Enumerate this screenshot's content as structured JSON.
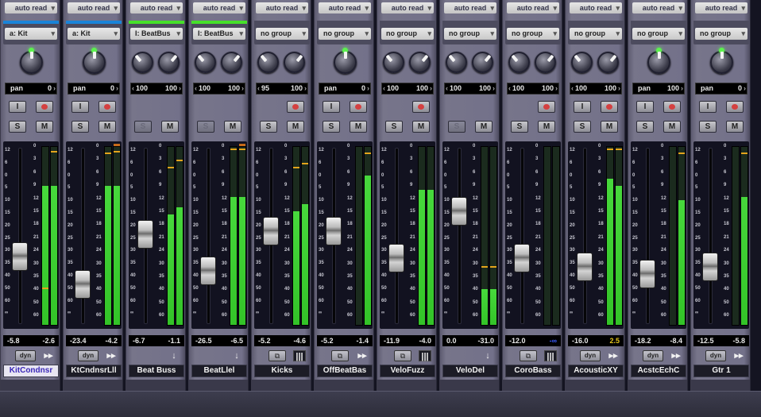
{
  "colors": {
    "meter_green": "#3fd033",
    "peak_amber": "#e3a41c",
    "record_red": "#d44040",
    "pan_knob_green": "#5cf24e",
    "selected_name_text": "#3b28b8"
  },
  "fader_scale_left": [
    "12",
    "6",
    "0",
    "5",
    "10",
    "15",
    "20",
    "25",
    "30",
    "35",
    "40",
    "50",
    "60",
    "∞"
  ],
  "meter_scale_right": [
    "0",
    "3",
    "6",
    "9",
    "12",
    "15",
    "18",
    "21",
    "24",
    "30",
    "35",
    "40",
    "50",
    "60"
  ],
  "strips": [
    {
      "automation": "auto read",
      "group": "a: Kit",
      "group_color": "#1a84d8",
      "knobs": [
        0.5
      ],
      "pan": [
        "pan",
        "0"
      ],
      "buttons": [
        "I",
        "rec",
        "S",
        "M"
      ],
      "record_visible": true,
      "solo_dim": false,
      "fader_level": 0.37,
      "meters": [
        0.78,
        0.78
      ],
      "peaks": [
        0.2,
        0.97
      ],
      "clip": false,
      "readout": [
        "-5.8",
        "-2.6"
      ],
      "row3": {
        "type": "dyn",
        "label": "dyn"
      },
      "tail": "▸▸",
      "name": "KitCondnsr",
      "selected": true
    },
    {
      "automation": "auto read",
      "group": "a: Kit",
      "group_color": "#1a84d8",
      "knobs": [
        0.5
      ],
      "pan": [
        "pan",
        "0"
      ],
      "buttons": [
        "I",
        "rec",
        "S",
        "M"
      ],
      "record_visible": true,
      "solo_dim": false,
      "fader_level": 0.18,
      "meters": [
        0.78,
        0.78
      ],
      "peaks": [
        0.96,
        0.97
      ],
      "clip": true,
      "readout": [
        "-23.4",
        "-4.2"
      ],
      "row3": {
        "type": "dyn",
        "label": "dyn"
      },
      "tail": "▸▸",
      "name": "KtCndnsrLll",
      "selected": false
    },
    {
      "automation": "auto read",
      "group": "I: BeatBus",
      "group_color": "#46e02a",
      "knobs": [
        0.3,
        0.7
      ],
      "pan": [
        "100",
        "100"
      ],
      "buttons": [
        "",
        "",
        "S",
        "M"
      ],
      "record_visible": false,
      "solo_dim": true,
      "fader_level": 0.53,
      "meters": [
        0.62,
        0.66
      ],
      "peaks": [
        0.88,
        0.92
      ],
      "clip": false,
      "readout": [
        "-6.7",
        "-1.1"
      ],
      "row3": {
        "type": "none",
        "label": ""
      },
      "tail": "↓",
      "name": "Beat Buss",
      "selected": false
    },
    {
      "automation": "auto read",
      "group": "I: BeatBus",
      "group_color": "#46e02a",
      "knobs": [
        0.3,
        0.7
      ],
      "pan": [
        "100",
        "100"
      ],
      "buttons": [
        "",
        "",
        "S",
        "M"
      ],
      "record_visible": false,
      "solo_dim": true,
      "fader_level": 0.27,
      "meters": [
        0.72,
        0.72
      ],
      "peaks": [
        0.98,
        0.98
      ],
      "clip": true,
      "readout": [
        "-26.5",
        "-6.5"
      ],
      "row3": {
        "type": "none",
        "label": ""
      },
      "tail": "↓",
      "name": "BeatLlel",
      "selected": false
    },
    {
      "automation": "auto read",
      "group": "no group",
      "group_color": "#4c4b5e",
      "knobs": [
        0.3,
        0.7
      ],
      "pan": [
        "95",
        "100"
      ],
      "buttons": [
        "",
        "rec",
        "S",
        "M"
      ],
      "record_visible": true,
      "solo_dim": false,
      "fader_level": 0.55,
      "meters": [
        0.64,
        0.68
      ],
      "peaks": [
        0.88,
        0.9
      ],
      "clip": false,
      "readout": [
        "-5.2",
        "-4.6"
      ],
      "row3": {
        "type": "icon",
        "label": "⧉"
      },
      "tail": "|||",
      "name": "Kicks",
      "selected": false
    },
    {
      "automation": "auto read",
      "group": "no group",
      "group_color": "#4c4b5e",
      "knobs": [
        0.5
      ],
      "pan": [
        "pan",
        "0"
      ],
      "buttons": [
        "I",
        "rec",
        "S",
        "M"
      ],
      "record_visible": true,
      "solo_dim": false,
      "fader_level": 0.55,
      "meters": [
        0.0,
        0.84
      ],
      "peaks": [
        0.0,
        0.96
      ],
      "clip": false,
      "readout": [
        "-5.2",
        "-1.4"
      ],
      "row3": {
        "type": "icon",
        "label": "⧉"
      },
      "tail": "▸▸",
      "name": "OffBeatBas",
      "selected": false
    },
    {
      "automation": "auto read",
      "group": "no group",
      "group_color": "#4c4b5e",
      "knobs": [
        0.3,
        0.7
      ],
      "pan": [
        "100",
        "100"
      ],
      "buttons": [
        "",
        "rec",
        "S",
        "M"
      ],
      "record_visible": true,
      "solo_dim": false,
      "fader_level": 0.36,
      "meters": [
        0.76,
        0.76
      ],
      "peaks": [
        0.0,
        0.0
      ],
      "clip": false,
      "readout": [
        "-11.9",
        "-4.0"
      ],
      "row3": {
        "type": "icon",
        "label": "⧉"
      },
      "tail": "|||",
      "name": "VeloFuzz",
      "selected": false
    },
    {
      "automation": "auto read",
      "group": "no group",
      "group_color": "#4c4b5e",
      "knobs": [
        0.3,
        0.7
      ],
      "pan": [
        "100",
        "100"
      ],
      "buttons": [
        "",
        "",
        "S",
        "M"
      ],
      "record_visible": false,
      "solo_dim": true,
      "fader_level": 0.69,
      "meters": [
        0.2,
        0.2
      ],
      "peaks": [
        0.32,
        0.32
      ],
      "clip": false,
      "readout": [
        "0.0",
        "-31.0"
      ],
      "row3": {
        "type": "none",
        "label": ""
      },
      "tail": "↓",
      "name": "VeloDel",
      "selected": false
    },
    {
      "automation": "auto read",
      "group": "no group",
      "group_color": "#4c4b5e",
      "knobs": [
        0.3,
        0.7
      ],
      "pan": [
        "100",
        "100"
      ],
      "buttons": [
        "",
        "rec",
        "S",
        "M"
      ],
      "record_visible": true,
      "solo_dim": false,
      "fader_level": 0.36,
      "meters": [
        0.0,
        0.0
      ],
      "peaks": [
        0.0,
        0.0
      ],
      "clip": false,
      "readout": [
        "-12.0",
        "-∞"
      ],
      "row3": {
        "type": "icon",
        "label": "⧉"
      },
      "tail": "|||",
      "name": "CoroBass",
      "selected": false
    },
    {
      "automation": "auto read",
      "group": "no group",
      "group_color": "#4c4b5e",
      "knobs": [
        0.3,
        0.7
      ],
      "pan": [
        "100",
        "100"
      ],
      "buttons": [
        "I",
        "rec",
        "S",
        "M"
      ],
      "record_visible": true,
      "solo_dim": false,
      "fader_level": 0.3,
      "meters": [
        0.82,
        0.78
      ],
      "peaks": [
        0.98,
        0.98
      ],
      "clip": false,
      "readout": [
        "-16.0",
        "2.5"
      ],
      "row3": {
        "type": "dyn",
        "label": "dyn"
      },
      "tail": "▸▸",
      "name": "AcousticXY",
      "selected": false
    },
    {
      "automation": "auto read",
      "group": "no group",
      "group_color": "#4c4b5e",
      "knobs": [
        0.5
      ],
      "pan": [
        "pan",
        "100"
      ],
      "buttons": [
        "I",
        "rec",
        "S",
        "M"
      ],
      "record_visible": true,
      "solo_dim": false,
      "fader_level": 0.25,
      "meters": [
        0.0,
        0.7
      ],
      "peaks": [
        0.0,
        0.96
      ],
      "clip": false,
      "readout": [
        "-18.2",
        "-8.4"
      ],
      "row3": {
        "type": "dyn",
        "label": "dyn"
      },
      "tail": "▸▸",
      "name": "AcstcEchC",
      "selected": false
    },
    {
      "automation": "auto read",
      "group": "no group",
      "group_color": "#4c4b5e",
      "knobs": [
        0.5
      ],
      "pan": [
        "pan",
        "0"
      ],
      "buttons": [
        "I",
        "rec",
        "S",
        "M"
      ],
      "record_visible": true,
      "solo_dim": false,
      "fader_level": 0.3,
      "meters": [
        0.0,
        0.72
      ],
      "peaks": [
        0.0,
        0.96
      ],
      "clip": false,
      "readout": [
        "-12.5",
        "-5.8"
      ],
      "row3": {
        "type": "dyn",
        "label": "dyn"
      },
      "tail": "▸▸",
      "name": "Gtr 1",
      "selected": false
    }
  ]
}
